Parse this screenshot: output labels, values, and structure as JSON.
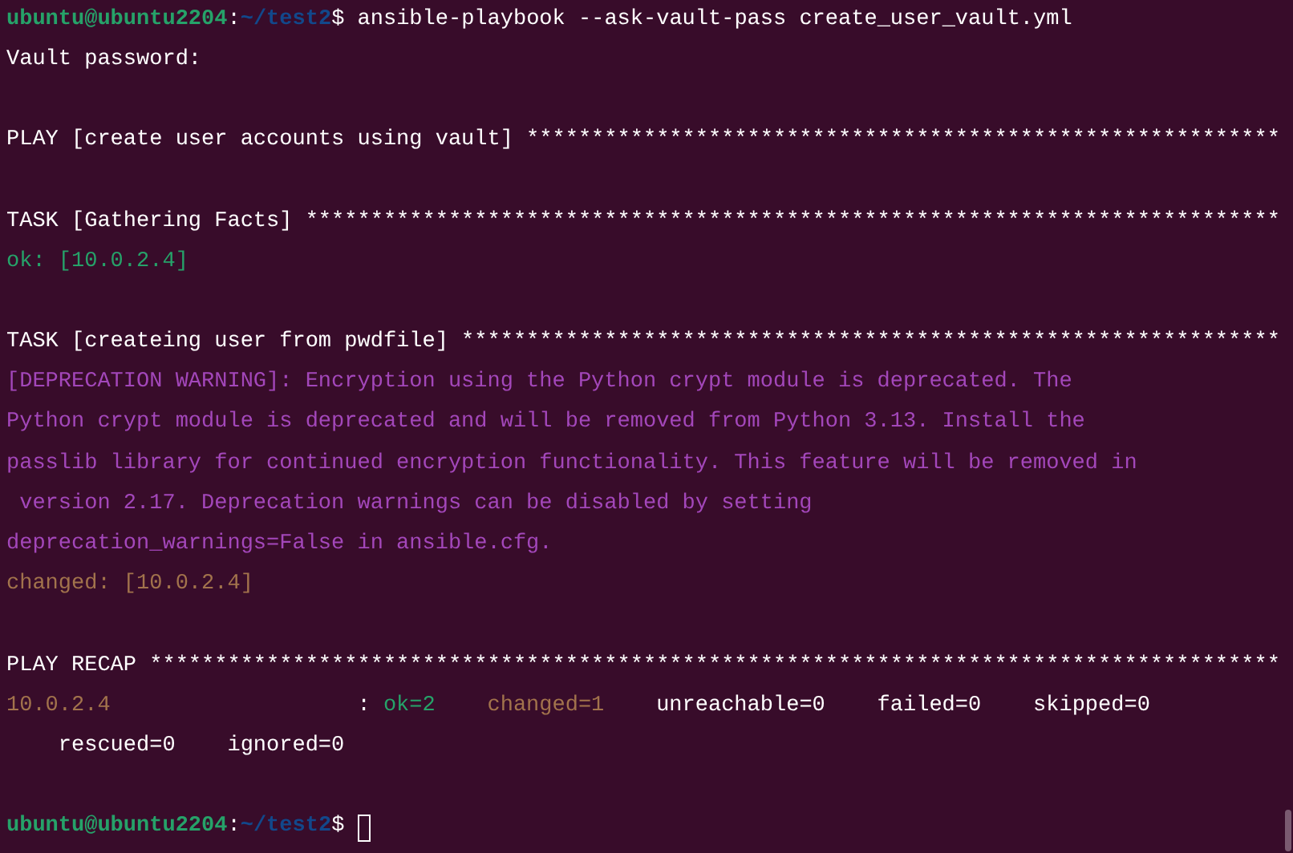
{
  "terminal": {
    "lines": [
      {
        "kind": "text",
        "segments": [
          {
            "kind": "user",
            "text": "ubuntu@ubuntu2204"
          },
          {
            "kind": "plain",
            "text": ":"
          },
          {
            "kind": "path",
            "text": "~/test2"
          },
          {
            "kind": "plain",
            "text": "$ ansible-playbook --ask-vault-pass create_user_vault.yml"
          }
        ]
      },
      {
        "kind": "text",
        "segments": [
          {
            "kind": "plain",
            "text": "Vault password:"
          }
        ]
      },
      {
        "kind": "blank"
      },
      {
        "kind": "text",
        "segments": [
          {
            "kind": "plain",
            "text": "PLAY [create user accounts using vault] **********************************************************"
          }
        ]
      },
      {
        "kind": "blank"
      },
      {
        "kind": "text",
        "segments": [
          {
            "kind": "plain",
            "text": "TASK [Gathering Facts] ***************************************************************************"
          }
        ]
      },
      {
        "kind": "text",
        "segments": [
          {
            "kind": "ok",
            "text": "ok: [10.0.2.4]"
          }
        ]
      },
      {
        "kind": "blank"
      },
      {
        "kind": "text",
        "segments": [
          {
            "kind": "plain",
            "text": "TASK [createing user from pwdfile] ***************************************************************"
          }
        ]
      },
      {
        "kind": "text",
        "segments": [
          {
            "kind": "warning",
            "text": "[DEPRECATION WARNING]: Encryption using the Python crypt module is deprecated. The"
          }
        ]
      },
      {
        "kind": "text",
        "segments": [
          {
            "kind": "warning",
            "text": "Python crypt module is deprecated and will be removed from Python 3.13. Install the"
          }
        ]
      },
      {
        "kind": "text",
        "segments": [
          {
            "kind": "warning",
            "text": "passlib library for continued encryption functionality. This feature will be removed in"
          }
        ]
      },
      {
        "kind": "text",
        "segments": [
          {
            "kind": "warning",
            "text": " version 2.17. Deprecation warnings can be disabled by setting"
          }
        ]
      },
      {
        "kind": "text",
        "segments": [
          {
            "kind": "warning",
            "text": "deprecation_warnings=False in ansible.cfg."
          }
        ]
      },
      {
        "kind": "text",
        "segments": [
          {
            "kind": "changed",
            "text": "changed: [10.0.2.4]"
          }
        ]
      },
      {
        "kind": "blank"
      },
      {
        "kind": "text",
        "segments": [
          {
            "kind": "plain",
            "text": "PLAY RECAP ***************************************************************************************"
          }
        ]
      },
      {
        "kind": "text",
        "segments": [
          {
            "kind": "changed",
            "text": "10.0.2.4"
          },
          {
            "kind": "plain",
            "text": "                   : "
          },
          {
            "kind": "ok",
            "text": "ok=2"
          },
          {
            "kind": "changed",
            "text": "changed=1"
          },
          {
            "kind": "plain",
            "text": "    unreachable=0    failed=0    skipped=0"
          }
        ]
      },
      {
        "kind": "text",
        "segments": [
          {
            "kind": "plain",
            "text": "    rescued=0    ignored=0"
          }
        ]
      },
      {
        "kind": "blank"
      },
      {
        "kind": "prompt",
        "segments": [
          {
            "kind": "user",
            "text": "ubuntu@ubuntu2204"
          },
          {
            "kind": "plain",
            "text": ":"
          },
          {
            "kind": "path",
            "text": "~/test2"
          },
          {
            "kind": "plain",
            "text": "$ "
          }
        ]
      }
    ]
  }
}
